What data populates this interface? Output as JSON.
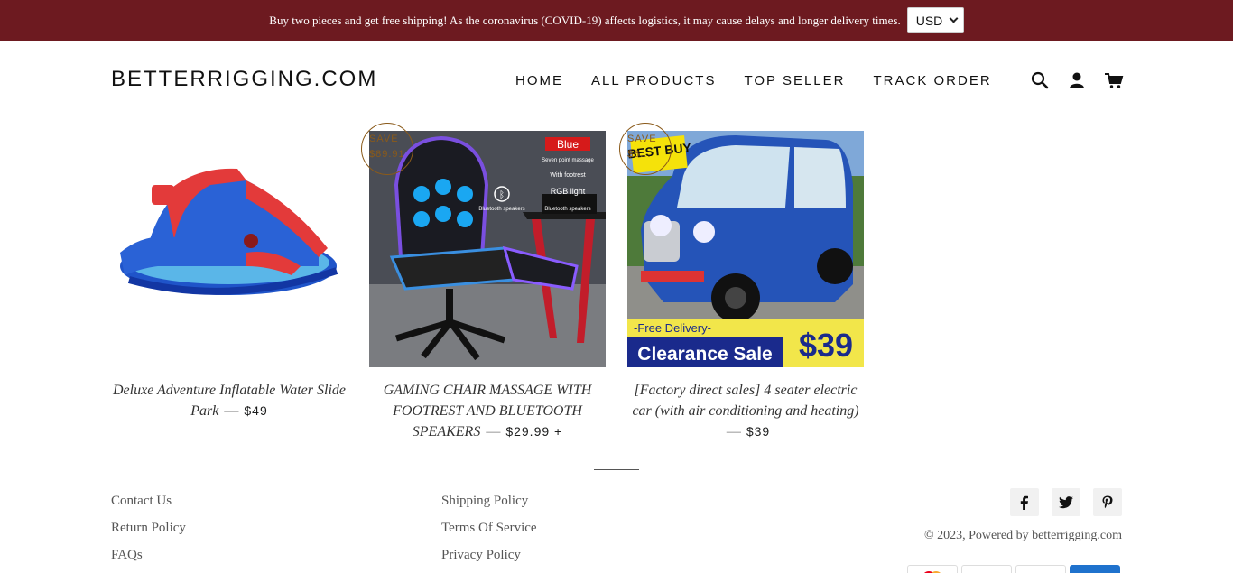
{
  "announcement": {
    "text": "Buy two pieces and get free shipping! As the coronavirus (COVID-19) affects logistics, it may cause delays and longer delivery times.",
    "currency": "USD"
  },
  "header": {
    "logo": "BETTERRIGGING.COM",
    "nav": [
      "HOME",
      "ALL PRODUCTS",
      "TOP SELLER",
      "TRACK ORDER"
    ],
    "icons": [
      "search-icon",
      "account-icon",
      "cart-icon"
    ]
  },
  "products": [
    {
      "title": "Deluxe Adventure Inflatable Water Slide Park",
      "price": "$49",
      "badge": null
    },
    {
      "title": "GAMING CHAIR MASSAGE WITH FOOTREST AND BLUETOOTH SPEAKERS",
      "price": "$29.99 +",
      "badge": {
        "label": "SAVE",
        "amount": "$89.91"
      },
      "image_text": {
        "color_tag": "Blue",
        "features": [
          "Seven point massage",
          "With footrest",
          "RGB light",
          "Bluetooth speakers"
        ]
      }
    },
    {
      "title": "[Factory direct sales] 4 seater electric car (with air conditioning and heating)",
      "price": "$39",
      "badge": {
        "label": "SAVE",
        "amount": "$6..."
      },
      "image_text": {
        "best_buy": "BEST BUY",
        "delivery": "-Free Delivery-",
        "sale": "Clearance Sale",
        "sale_price": "$39"
      }
    }
  ],
  "footer": {
    "links_col1": [
      "Contact Us",
      "Return Policy",
      "FAQs"
    ],
    "links_col2": [
      "Shipping Policy",
      "Terms Of Service",
      "Privacy Policy"
    ],
    "social": [
      "facebook-icon",
      "twitter-icon",
      "pinterest-icon"
    ],
    "copyright": "© 2023, Powered by betterrigging.com"
  },
  "colors": {
    "announcement_bg": "#6d1a20",
    "badge": "#8a5a1a",
    "sale_banner_bg": "#1a2a8c",
    "sale_banner_yellow": "#f2e64a"
  }
}
